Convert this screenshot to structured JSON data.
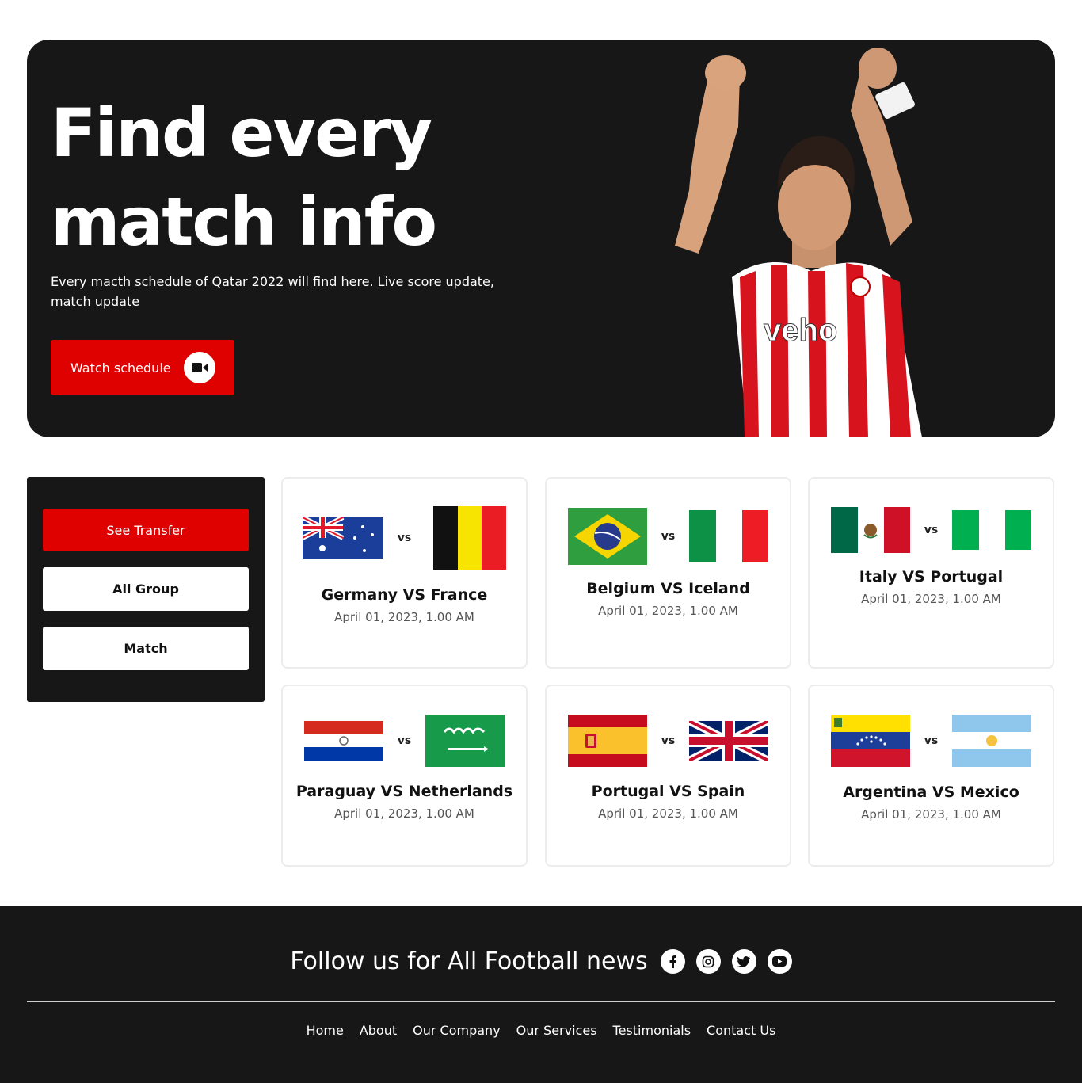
{
  "hero": {
    "title": "Find every match info",
    "subtitle": "Every macth schedule of Qatar 2022 will find here. Live score update, match update",
    "button_label": "Watch schedule",
    "button_icon": "video-camera-icon",
    "accent_color": "#df0000",
    "background_color": "#171717",
    "player_sponsor": "veho"
  },
  "sidebar": {
    "items": [
      {
        "label": "See Transfer",
        "style": "primary"
      },
      {
        "label": "All Group",
        "style": "secondary"
      },
      {
        "label": "Match",
        "style": "secondary"
      }
    ]
  },
  "matches": [
    {
      "title": "Germany VS France",
      "date": "April 01, 2023, 1.00 AM",
      "vs": "vs",
      "flag_left": "australia-flag-icon",
      "flag_right": "belgium-flag-icon"
    },
    {
      "title": "Belgium VS Iceland",
      "date": "April 01, 2023, 1.00 AM",
      "vs": "vs",
      "flag_left": "brazil-flag-icon",
      "flag_right": "italy-flag-icon"
    },
    {
      "title": "Italy VS Portugal",
      "date": "April 01, 2023, 1.00 AM",
      "vs": "vs",
      "flag_left": "mexico-flag-icon",
      "flag_right": "nigeria-flag-icon"
    },
    {
      "title": "Paraguay VS Netherlands",
      "date": "April 01, 2023, 1.00 AM",
      "vs": "vs",
      "flag_left": "paraguay-flag-icon",
      "flag_right": "saudi-arabia-flag-icon"
    },
    {
      "title": "Portugal VS Spain",
      "date": "April 01, 2023, 1.00 AM",
      "vs": "vs",
      "flag_left": "spain-flag-icon",
      "flag_right": "united-kingdom-flag-icon"
    },
    {
      "title": "Argentina VS Mexico",
      "date": "April 01, 2023, 1.00 AM",
      "vs": "vs",
      "flag_left": "venezuela-flag-icon",
      "flag_right": "argentina-flag-icon"
    }
  ],
  "footer": {
    "follow_text": "Follow us for All Football news",
    "social_icons": [
      "facebook-icon",
      "instagram-icon",
      "twitter-icon",
      "youtube-icon"
    ],
    "nav": [
      "Home",
      "About",
      "Our Company",
      "Our Services",
      "Testimonials",
      "Contact Us"
    ]
  }
}
